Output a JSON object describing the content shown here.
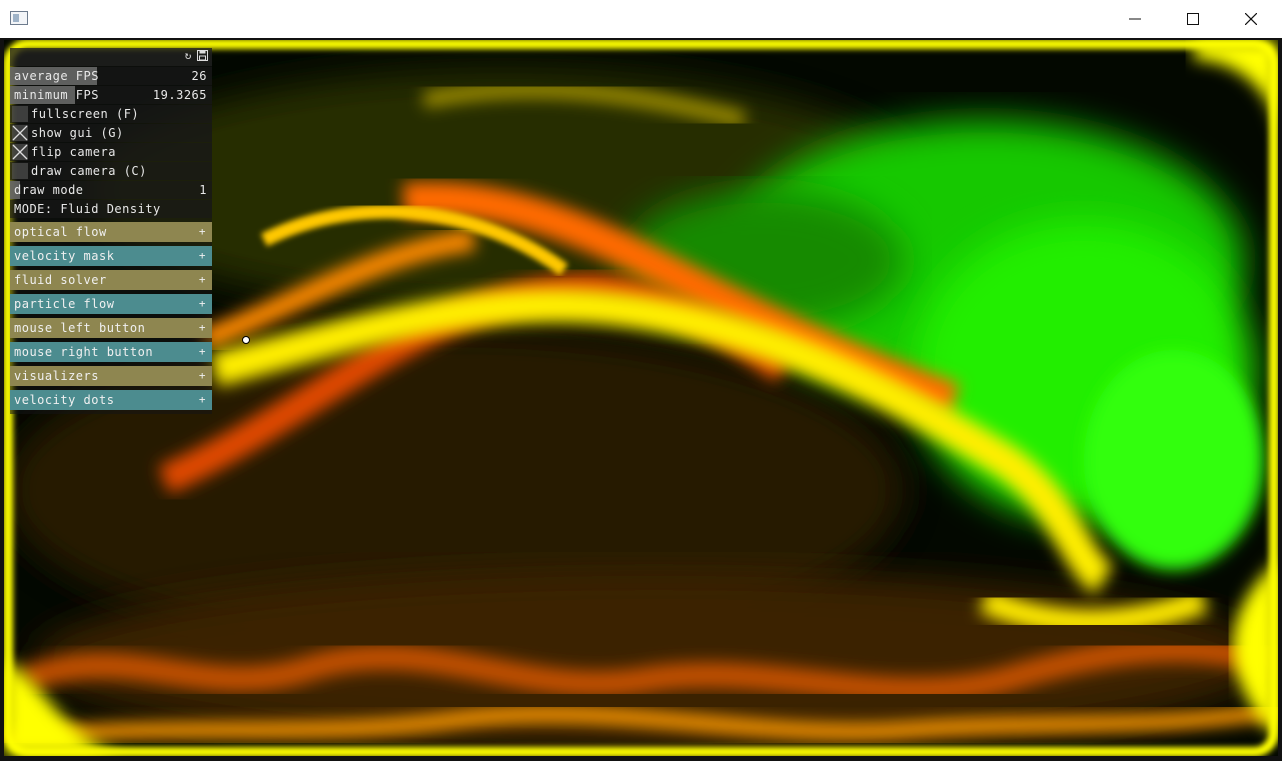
{
  "window": {
    "title": "",
    "icons": {
      "app": "app-window-icon",
      "minimize": "minimize-icon",
      "maximize": "maximize-icon",
      "close": "close-icon"
    }
  },
  "gui": {
    "header_icons": [
      "refresh-icon",
      "save-icon"
    ],
    "rows": [
      {
        "name": "average-fps",
        "label": "average FPS",
        "value": "26",
        "fill": 0.43
      },
      {
        "name": "minimum-fps",
        "label": "minimum FPS",
        "value": "19.3265",
        "fill": 0.32
      }
    ],
    "toggles": [
      {
        "name": "fullscreen",
        "label": "fullscreen (F)",
        "checked": false
      },
      {
        "name": "show-gui",
        "label": "show gui (G)",
        "checked": true
      },
      {
        "name": "flip-camera",
        "label": "flip camera",
        "checked": true
      },
      {
        "name": "draw-camera",
        "label": "draw camera (C)",
        "checked": false
      }
    ],
    "draw_mode": {
      "label": "draw mode",
      "value": "1",
      "fill": 0.05
    },
    "mode_text": "MODE: Fluid Density",
    "groups": [
      {
        "name": "optical-flow",
        "label": "optical flow",
        "style": "olive"
      },
      {
        "name": "velocity-mask",
        "label": "velocity mask",
        "style": "teal"
      },
      {
        "name": "fluid-solver",
        "label": "fluid solver",
        "style": "olive"
      },
      {
        "name": "particle-flow",
        "label": "particle flow",
        "style": "teal"
      },
      {
        "name": "mouse-left-button",
        "label": "mouse left button",
        "style": "olive"
      },
      {
        "name": "mouse-right-button",
        "label": "mouse right button",
        "style": "teal"
      },
      {
        "name": "visualizers",
        "label": "visualizers",
        "style": "olive"
      },
      {
        "name": "velocity-dots",
        "label": "velocity dots",
        "style": "teal"
      }
    ],
    "expand_symbol": "+"
  },
  "colors": {
    "group_olive": "#8e8650",
    "group_teal": "#4c8c8f",
    "fluid_yellow": "#ffff00",
    "fluid_orange": "#ff7a00",
    "fluid_green": "#22ff00"
  }
}
